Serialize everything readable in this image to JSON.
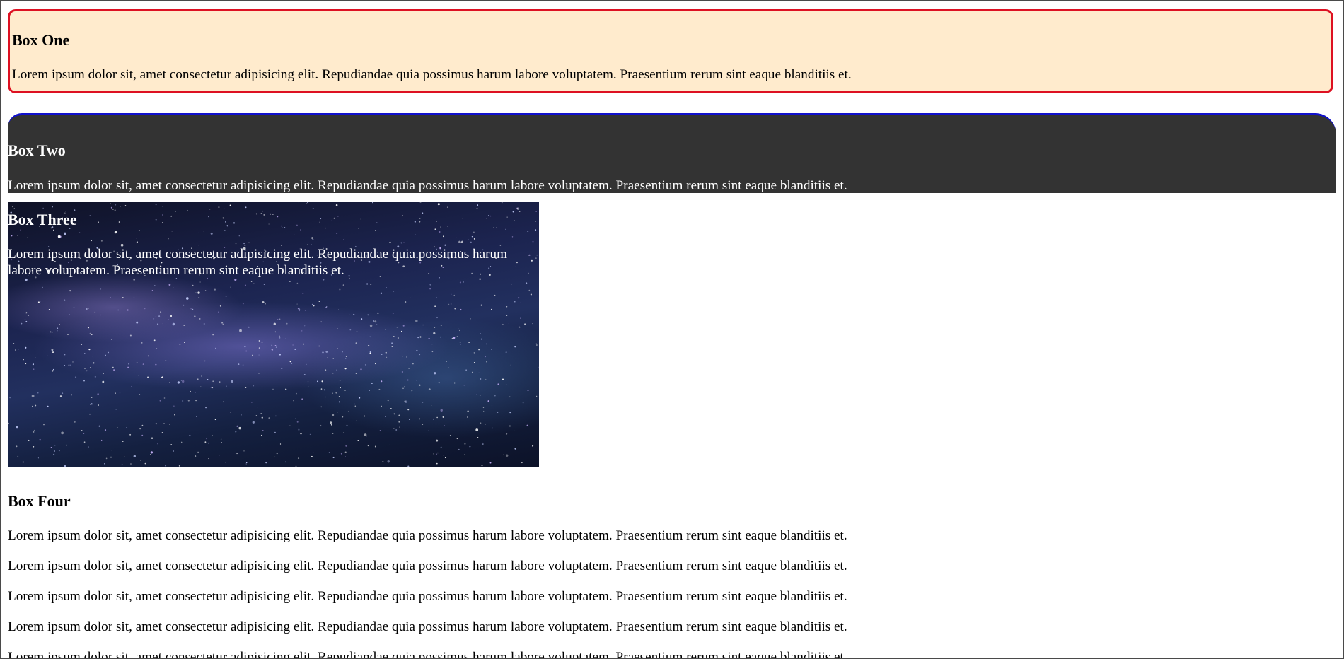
{
  "box_one": {
    "title": "Box One",
    "text": "Lorem ipsum dolor sit, amet consectetur adipisicing elit. Repudiandae quia possimus harum labore voluptatem. Praesentium rerum sint eaque blanditiis et."
  },
  "box_two": {
    "title": "Box Two",
    "text": "Lorem ipsum dolor sit, amet consectetur adipisicing elit. Repudiandae quia possimus harum labore voluptatem. Praesentium rerum sint eaque blanditiis et."
  },
  "box_three": {
    "title": "Box Three",
    "text": "Lorem ipsum dolor sit, amet consectetur adipisicing elit. Repudiandae quia possimus harum labore voluptatem. Praesentium rerum sint eaque blanditiis et."
  },
  "box_four": {
    "title": "Box Four",
    "paragraphs": [
      "Lorem ipsum dolor sit, amet consectetur adipisicing elit. Repudiandae quia possimus harum labore voluptatem. Praesentium rerum sint eaque blanditiis et.",
      "Lorem ipsum dolor sit, amet consectetur adipisicing elit. Repudiandae quia possimus harum labore voluptatem. Praesentium rerum sint eaque blanditiis et.",
      "Lorem ipsum dolor sit, amet consectetur adipisicing elit. Repudiandae quia possimus harum labore voluptatem. Praesentium rerum sint eaque blanditiis et.",
      "Lorem ipsum dolor sit, amet consectetur adipisicing elit. Repudiandae quia possimus harum labore voluptatem. Praesentium rerum sint eaque blanditiis et.",
      "Lorem ipsum dolor sit, amet consectetur adipisicing elit. Repudiandae quia possimus harum labore voluptatem. Praesentium rerum sint eaque blanditiis et."
    ]
  },
  "colors": {
    "box_one_background": "#ffebcd",
    "box_one_border": "#dd1122",
    "box_two_background": "#333333",
    "box_two_border_top": "#1111cc"
  }
}
